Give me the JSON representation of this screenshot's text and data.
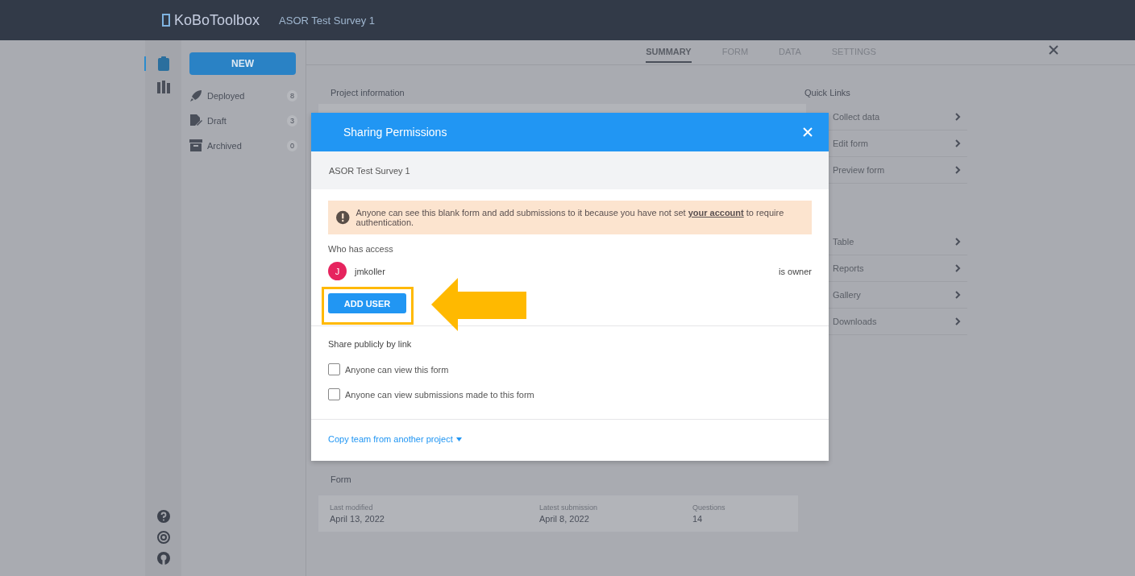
{
  "top_bar": {
    "logo": "KoBoToolbox",
    "project_title": "ASOR Test Survey 1"
  },
  "rail": {
    "items": [
      {
        "kind": "forms",
        "selected": true
      },
      {
        "kind": "library",
        "selected": false
      }
    ]
  },
  "sidebar": {
    "new_button": "NEW",
    "items": [
      {
        "kind": "deployed",
        "label": "Deployed",
        "count": "8"
      },
      {
        "kind": "draft",
        "label": "Draft",
        "count": "3"
      },
      {
        "kind": "archived",
        "label": "Archived",
        "count": "0"
      }
    ]
  },
  "tabs": [
    {
      "label": "SUMMARY",
      "selected": true
    },
    {
      "label": "FORM",
      "selected": false
    },
    {
      "label": "DATA",
      "selected": false
    },
    {
      "label": "SETTINGS",
      "selected": false
    }
  ],
  "summary": {
    "project_information_heading": "Project information",
    "quick_links_heading": "Quick Links",
    "quick_link_groups": [
      {
        "items": [
          "Collect data",
          "Edit form",
          "Preview form"
        ]
      },
      {
        "items": [
          "Table",
          "Reports",
          "Gallery",
          "Downloads"
        ]
      }
    ],
    "form_heading": "Form",
    "form_stats": [
      {
        "label": "Last modified",
        "value": "April 13, 2022"
      },
      {
        "label": "Latest submission",
        "value": "April 8, 2022"
      },
      {
        "label": "Questions",
        "value": "14"
      }
    ]
  },
  "dialog": {
    "title": "Sharing Permissions",
    "subtitle": "ASOR Test Survey 1",
    "warning": "Anyone can see this blank form and add submissions to it because you have not set **your account** to require authentication.",
    "access_heading": "Who has access",
    "users": [
      {
        "initial": "J",
        "name": "jmkoller",
        "role": "is owner"
      }
    ],
    "add_user_button": "ADD USER",
    "public_heading": "Share publicly by link",
    "public_options": [
      {
        "label": "Anyone can view this form",
        "checked": false
      },
      {
        "label": "Anyone can view submissions made to this form",
        "checked": false
      }
    ],
    "copy_team_link": "Copy team from another project"
  }
}
